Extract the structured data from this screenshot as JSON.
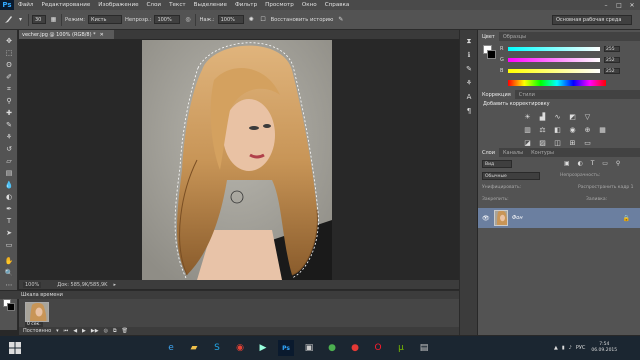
{
  "app": {
    "logo": "Ps"
  },
  "menu": [
    "Файл",
    "Редактирование",
    "Изображение",
    "Слои",
    "Текст",
    "Выделение",
    "Фильтр",
    "Просмотр",
    "Окно",
    "Справка"
  ],
  "window_controls": [
    "–",
    "□",
    "✕"
  ],
  "options": {
    "tool_icon": "brush-icon",
    "brush_size": "30",
    "mode_label": "Режим:",
    "mode_value": "Кисть",
    "opacity_label": "Непрозр.:",
    "opacity_value": "100%",
    "flow_label": "Наж.:",
    "flow_value": "100%",
    "restore_label": "Восстановить историю",
    "workspace": "Основная рабочая среда"
  },
  "document": {
    "tab_title": "vecher.jpg @ 100% (RGB/8) *",
    "zoom": "100%",
    "doc_info": "Док: 585,9K/585,9K"
  },
  "timeline": {
    "title": "Шкала времени",
    "clip_label": "0 сек.",
    "mode": "Постоянно"
  },
  "color_panel": {
    "tabs": [
      "Цвет",
      "Образцы"
    ],
    "channels": [
      {
        "label": "R",
        "value": "255"
      },
      {
        "label": "G",
        "value": "252"
      },
      {
        "label": "B",
        "value": "252"
      }
    ]
  },
  "adjustments_panel": {
    "tabs": [
      "Коррекция",
      "Стили"
    ],
    "hint": "Добавить корректировку"
  },
  "layers_panel": {
    "tabs": [
      "Слои",
      "Каналы",
      "Контуры"
    ],
    "kind_filter": "Вид",
    "blend_mode": "Обычные",
    "opacity_label": "Непрозрачность:",
    "lock_label": "Закрепить:",
    "fill_label": "Заливка:",
    "unify_label": "Унифицировать:",
    "propagate_label": "Распространить кадр 1",
    "layer_name": "Фон"
  },
  "taskbar": {
    "lang": "РУС",
    "time": "7:54",
    "date": "06.09.2015"
  },
  "colors": {
    "accent": "#31a8ff",
    "layer_selected": "#6b7fa0",
    "taskbar": "#1b2631"
  }
}
